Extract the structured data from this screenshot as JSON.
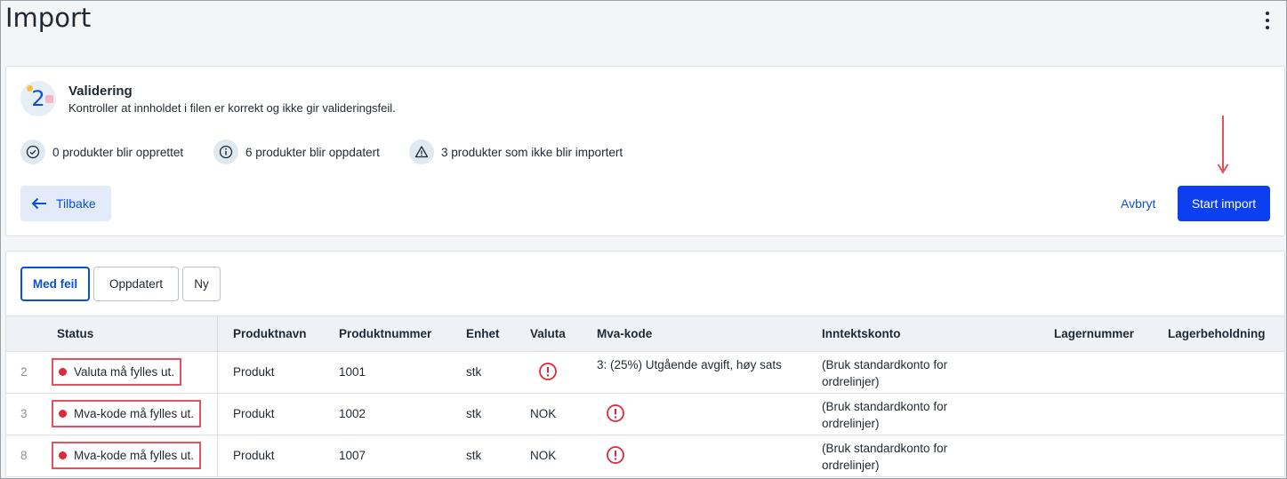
{
  "page": {
    "title": "Import"
  },
  "step": {
    "number": "2",
    "title": "Validering",
    "description": "Kontroller at innholdet i filen er korrekt og ikke gir valideringsfeil."
  },
  "stats": [
    {
      "icon": "check-circle-icon",
      "label": "0 produkter blir opprettet"
    },
    {
      "icon": "info-circle-icon",
      "label": "6 produkter blir oppdatert"
    },
    {
      "icon": "warning-triangle-icon",
      "label": "3 produkter som ikke blir importert"
    }
  ],
  "actions": {
    "back_label": "Tilbake",
    "cancel_label": "Avbryt",
    "start_label": "Start import"
  },
  "tabs": [
    {
      "label": "Med feil",
      "active": true
    },
    {
      "label": "Oppdatert",
      "active": false
    },
    {
      "label": "Ny",
      "active": false
    }
  ],
  "table": {
    "columns": [
      "Status",
      "Produktnavn",
      "Produktnummer",
      "Enhet",
      "Valuta",
      "Mva-kode",
      "Inntektskonto",
      "Lagernummer",
      "Lagerbeholdning"
    ],
    "rows": [
      {
        "row": "2",
        "status": "Valuta må fylles ut.",
        "name": "Produkt",
        "number": "1001",
        "unit": "stk",
        "currency": "",
        "currency_error": true,
        "vat": "3: (25%) Utgående avgift, høy sats",
        "vat_error": false,
        "income": "(Bruk standardkonto for ordrelinjer)",
        "stock_number": "",
        "stock": ""
      },
      {
        "row": "3",
        "status": "Mva-kode må fylles ut.",
        "name": "Produkt",
        "number": "1002",
        "unit": "stk",
        "currency": "NOK",
        "currency_error": false,
        "vat": "",
        "vat_error": true,
        "income": "(Bruk standardkonto for ordrelinjer)",
        "stock_number": "",
        "stock": ""
      },
      {
        "row": "8",
        "status": "Mva-kode må fylles ut.",
        "name": "Produkt",
        "number": "1007",
        "unit": "stk",
        "currency": "NOK",
        "currency_error": false,
        "vat": "",
        "vat_error": true,
        "income": "(Bruk standardkonto for ordrelinjer)",
        "stock_number": "",
        "stock": ""
      }
    ]
  },
  "colors": {
    "accent": "#0b4fd6",
    "primary_button": "#0b3ff0",
    "error": "#d92b3a",
    "annotation": "#e5525f"
  }
}
